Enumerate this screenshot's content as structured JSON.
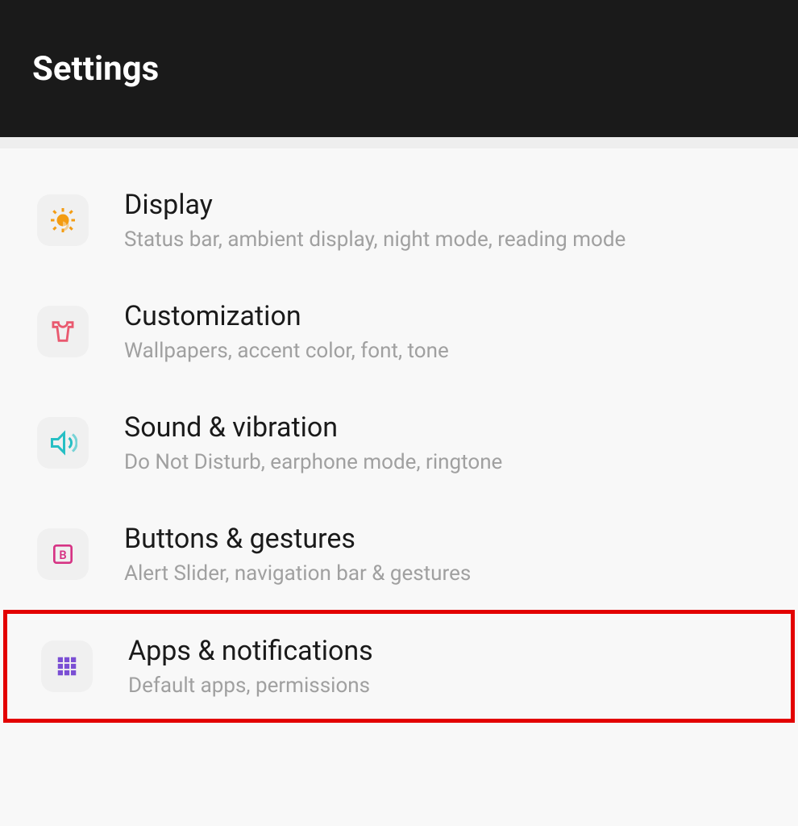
{
  "header": {
    "title": "Settings"
  },
  "items": [
    {
      "icon": "display-icon",
      "title": "Display",
      "subtitle": "Status bar, ambient display, night mode, reading mode"
    },
    {
      "icon": "customization-icon",
      "title": "Customization",
      "subtitle": "Wallpapers, accent color, font, tone"
    },
    {
      "icon": "sound-icon",
      "title": "Sound & vibration",
      "subtitle": "Do Not Disturb, earphone mode, ringtone"
    },
    {
      "icon": "buttons-icon",
      "title": "Buttons & gestures",
      "subtitle": "Alert Slider, navigation bar & gestures"
    },
    {
      "icon": "apps-icon",
      "title": "Apps & notifications",
      "subtitle": "Default apps, permissions"
    }
  ]
}
